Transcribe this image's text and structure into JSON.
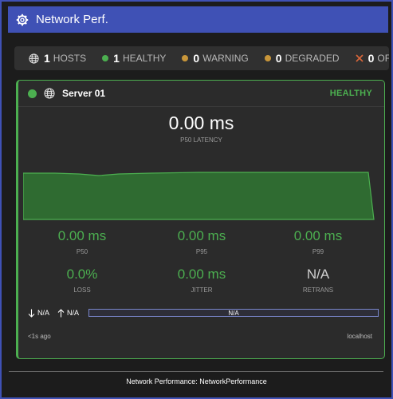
{
  "app": {
    "title": "Network Perf."
  },
  "summary": {
    "hosts": {
      "count": "1",
      "label": "HOSTS"
    },
    "healthy": {
      "count": "1",
      "label": "HEALTHY",
      "color": "#4caf50"
    },
    "warning": {
      "count": "0",
      "label": "WARNING",
      "color": "#c8963a"
    },
    "degraded": {
      "count": "0",
      "label": "DEGRADED",
      "color": "#c8963a"
    },
    "offline": {
      "count": "0",
      "label": "OFFLIN",
      "color": "#d9663a"
    }
  },
  "server": {
    "name": "Server 01",
    "status": "HEALTHY",
    "status_color": "#4caf50",
    "p50_main": "0.00 ms",
    "p50_main_label": "P50 LATENCY",
    "metrics": [
      {
        "value": "0.00 ms",
        "label": "P50"
      },
      {
        "value": "0.00 ms",
        "label": "P95"
      },
      {
        "value": "0.00 ms",
        "label": "P99"
      },
      {
        "value": "0.0%",
        "label": "LOSS"
      },
      {
        "value": "0.00 ms",
        "label": "JITTER"
      },
      {
        "value": "N/A",
        "label": "RETRANS"
      }
    ],
    "download": "N/A",
    "upload": "N/A",
    "bandwidth": "N/A",
    "updated": "<1s ago",
    "host": "localhost"
  },
  "footer": {
    "text": "Network Performance: NetworkPerformance"
  },
  "colors": {
    "accent": "#3f51b5",
    "healthy": "#4caf50"
  }
}
